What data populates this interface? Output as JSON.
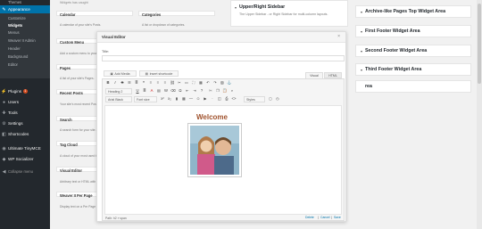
{
  "sidebar": {
    "items": [
      {
        "label": "Themes",
        "icon": "themes-icon",
        "sub": true
      },
      {
        "label": "Appearance",
        "icon": "appearance-icon"
      },
      {
        "label": "Customize",
        "sub": true
      },
      {
        "label": "Widgets",
        "sub": true
      },
      {
        "label": "Menus",
        "sub": true
      },
      {
        "label": "Weaver II Admin",
        "sub": true
      },
      {
        "label": "Header",
        "sub": true
      },
      {
        "label": "Background",
        "sub": true
      },
      {
        "label": "Editor",
        "sub": true
      }
    ],
    "plugins_label": "Plugins",
    "plugins_badge": "1",
    "users_label": "Users",
    "tools_label": "Tools",
    "settings_label": "Settings",
    "shortcodes_label": "Shortcodes",
    "tinymce_label": "Ultimate TinyMCE",
    "socializer_label": "WP Socializer",
    "collapse_label": "Collapse menu"
  },
  "available_widgets": {
    "top_text": "Widgets has caught",
    "left": [
      {
        "title": "Calendar",
        "desc": "A calendar of your site's Posts."
      },
      {
        "title": "Custom Menu",
        "desc": "Add a custom menu to your sidebar."
      },
      {
        "title": "Pages",
        "desc": "A list of your site's Pages."
      },
      {
        "title": "Recent Posts",
        "desc": "Your site's most recent Posts."
      },
      {
        "title": "Search",
        "desc": "A search form for your site."
      },
      {
        "title": "Tag Cloud",
        "desc": "A cloud of your most used tags."
      },
      {
        "title": "Visual Editor",
        "desc": "Arbitrary text or HTML with visual editor"
      },
      {
        "title": "Weaver II Per Page",
        "desc": "Display text on a Per Page basis"
      }
    ],
    "right": [
      {
        "title": "Categories",
        "desc": "A list or dropdown of categories."
      }
    ]
  },
  "sidebar_area": {
    "title": "Upper/Right Sidebar",
    "desc": "The Upper Sidebar - or Right Sidebar for multi-column layouts."
  },
  "widget_areas": [
    {
      "title": "Archive-like Pages Top Widget Area"
    },
    {
      "title": "First Footer Widget Area"
    },
    {
      "title": "Second Footer Widget Area"
    },
    {
      "title": "Third Footer Widget Area"
    },
    {
      "title": "rea"
    }
  ],
  "modal": {
    "title": "Visual Editor",
    "close": "×",
    "title_field_label": "Title:",
    "add_media": "Add Media",
    "insert_shortcode": "Insert shortcode",
    "tab_visual": "Visual",
    "tab_html": "HTML",
    "format_select": "Heading 2",
    "font_family": "Arial Black",
    "font_size": "Font size",
    "zoom": "Styles",
    "content_heading": "Welcome",
    "path": "Path: h2 » span",
    "actions": {
      "delete": "Delete",
      "cancel": "Cancel",
      "save": "Save"
    }
  },
  "colors": {
    "sidebar_bg": "#23282d",
    "sidebar_active": "#0073aa",
    "welcome": "#a0522d"
  }
}
